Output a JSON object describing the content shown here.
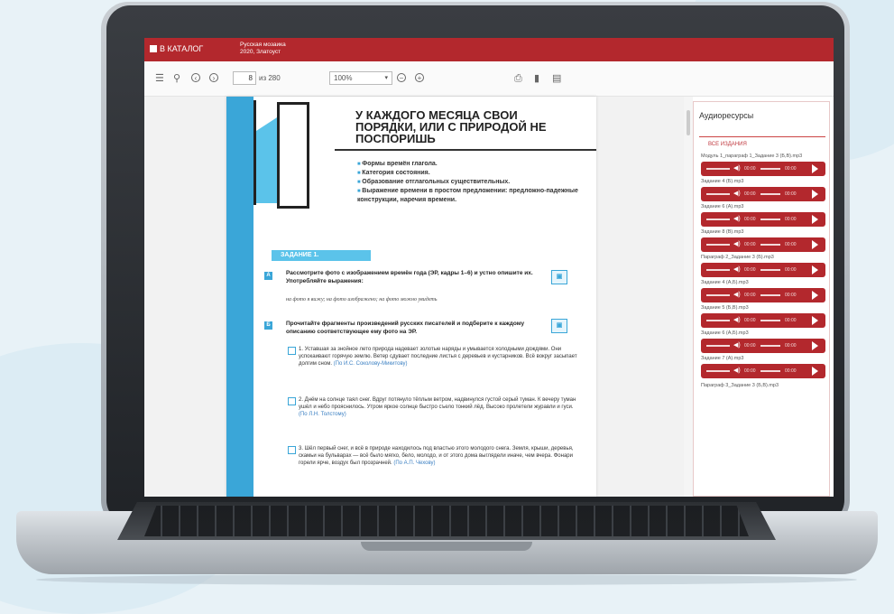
{
  "header": {
    "catalog_label": "В КАТАЛОГ",
    "book_title_1": "Русская мозаика",
    "book_title_2": "2020, Златоуст"
  },
  "toolbar": {
    "page_value": "8",
    "page_total": "из 280",
    "zoom_value": "100%"
  },
  "chapter": {
    "number": "1",
    "title": "У КАЖДОГО МЕСЯЦА СВОИ ПОРЯДКИ, ИЛИ С ПРИРОДОЙ НЕ ПОСПОРИШЬ",
    "topics": [
      "Формы времён глагола.",
      "Категория состояния.",
      "Образование отглагольных существительных.",
      "Выражение времени в простом предложении: предложно-падежные конструкции, наречия времени."
    ]
  },
  "task": {
    "label": "ЗАДАНИЕ 1.",
    "a_letter": "А",
    "a_text": "Рассмотрите фото с изображением времён года (ЭР, кадры 1–6) и устно опишите их. Употребляйте выражения:",
    "a_phrases": "на фото я вижу; на фото изображено; на фото можно увидеть",
    "b_letter": "Б",
    "b_text": "Прочитайте фрагменты произведений русских писателей и подберите к каждому описанию соответствующее ему фото на ЭР.",
    "fragments": [
      {
        "text": "1. Уставшая за знойное лето природа надевает золотые наряды и умывается холодными дождями. Они успокаивают горячую землю. Ветер сдувает последние листья с деревьев и кустарников. Всё вокруг засыпает долгим сном.",
        "source": "(По И.С. Соколову-Микитову)"
      },
      {
        "text": "2. Днём на солнце таял снег. Вдруг потянуло тёплым ветром, надвинулся густой серый туман. К вечеру туман ушёл и небо прояснилось. Утром яркое солнце быстро съело тонкий лёд. Высоко пролетели журавли и гуси.",
        "source": "(По Л.Н. Толстому)"
      },
      {
        "text": "3. Шёл первый снег, и всё в природе находилось под властью этого молодого снега. Земля, крыши, деревья, скамьи на бульварах — всё было мягко, бело, молодо, и от этого дома выглядели иначе, чем вчера. Фонари горели ярче, воздух был прозрачней.",
        "source": "(По А.П. Чехову)"
      }
    ]
  },
  "sidebar": {
    "title": "Аудиоресурсы",
    "all_editions": "ВСЕ ИЗДАНИЯ",
    "tracks": [
      {
        "name": "Модуль 1_параграф 1_Задание 3 (Б,В).mp3"
      },
      {
        "name": "Задание 4 (Б).mp3"
      },
      {
        "name": "Задание 6 (А).mp3"
      },
      {
        "name": "Задание 8 (В).mp3"
      },
      {
        "name": "Параграф 2_Задание 3 (Б).mp3"
      },
      {
        "name": "Задание 4 (А,Б).mp3"
      },
      {
        "name": "Задание 5 (Б,В).mp3"
      },
      {
        "name": "Задание 6 (А,Б).mp3"
      },
      {
        "name": "Задание 7 (А).mp3"
      }
    ],
    "last_track": "Параграф 3_Задание 3 (Б,В).mp3",
    "time_current": "00:00",
    "time_total": "00:00"
  },
  "colors": {
    "brand": "#b3282d",
    "accent": "#3aa6d8"
  }
}
